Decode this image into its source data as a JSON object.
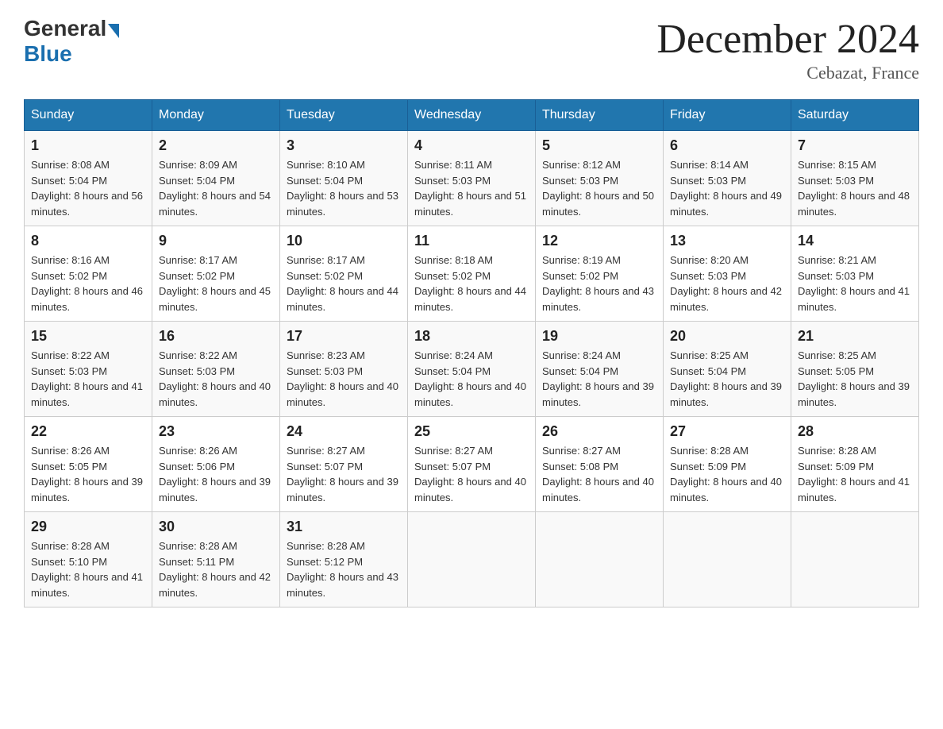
{
  "header": {
    "logo_general": "General",
    "logo_blue": "Blue",
    "title": "December 2024",
    "location": "Cebazat, France"
  },
  "days_of_week": [
    "Sunday",
    "Monday",
    "Tuesday",
    "Wednesday",
    "Thursday",
    "Friday",
    "Saturday"
  ],
  "weeks": [
    [
      {
        "day": "1",
        "sunrise": "8:08 AM",
        "sunset": "5:04 PM",
        "daylight": "8 hours and 56 minutes."
      },
      {
        "day": "2",
        "sunrise": "8:09 AM",
        "sunset": "5:04 PM",
        "daylight": "8 hours and 54 minutes."
      },
      {
        "day": "3",
        "sunrise": "8:10 AM",
        "sunset": "5:04 PM",
        "daylight": "8 hours and 53 minutes."
      },
      {
        "day": "4",
        "sunrise": "8:11 AM",
        "sunset": "5:03 PM",
        "daylight": "8 hours and 51 minutes."
      },
      {
        "day": "5",
        "sunrise": "8:12 AM",
        "sunset": "5:03 PM",
        "daylight": "8 hours and 50 minutes."
      },
      {
        "day": "6",
        "sunrise": "8:14 AM",
        "sunset": "5:03 PM",
        "daylight": "8 hours and 49 minutes."
      },
      {
        "day": "7",
        "sunrise": "8:15 AM",
        "sunset": "5:03 PM",
        "daylight": "8 hours and 48 minutes."
      }
    ],
    [
      {
        "day": "8",
        "sunrise": "8:16 AM",
        "sunset": "5:02 PM",
        "daylight": "8 hours and 46 minutes."
      },
      {
        "day": "9",
        "sunrise": "8:17 AM",
        "sunset": "5:02 PM",
        "daylight": "8 hours and 45 minutes."
      },
      {
        "day": "10",
        "sunrise": "8:17 AM",
        "sunset": "5:02 PM",
        "daylight": "8 hours and 44 minutes."
      },
      {
        "day": "11",
        "sunrise": "8:18 AM",
        "sunset": "5:02 PM",
        "daylight": "8 hours and 44 minutes."
      },
      {
        "day": "12",
        "sunrise": "8:19 AM",
        "sunset": "5:02 PM",
        "daylight": "8 hours and 43 minutes."
      },
      {
        "day": "13",
        "sunrise": "8:20 AM",
        "sunset": "5:03 PM",
        "daylight": "8 hours and 42 minutes."
      },
      {
        "day": "14",
        "sunrise": "8:21 AM",
        "sunset": "5:03 PM",
        "daylight": "8 hours and 41 minutes."
      }
    ],
    [
      {
        "day": "15",
        "sunrise": "8:22 AM",
        "sunset": "5:03 PM",
        "daylight": "8 hours and 41 minutes."
      },
      {
        "day": "16",
        "sunrise": "8:22 AM",
        "sunset": "5:03 PM",
        "daylight": "8 hours and 40 minutes."
      },
      {
        "day": "17",
        "sunrise": "8:23 AM",
        "sunset": "5:03 PM",
        "daylight": "8 hours and 40 minutes."
      },
      {
        "day": "18",
        "sunrise": "8:24 AM",
        "sunset": "5:04 PM",
        "daylight": "8 hours and 40 minutes."
      },
      {
        "day": "19",
        "sunrise": "8:24 AM",
        "sunset": "5:04 PM",
        "daylight": "8 hours and 39 minutes."
      },
      {
        "day": "20",
        "sunrise": "8:25 AM",
        "sunset": "5:04 PM",
        "daylight": "8 hours and 39 minutes."
      },
      {
        "day": "21",
        "sunrise": "8:25 AM",
        "sunset": "5:05 PM",
        "daylight": "8 hours and 39 minutes."
      }
    ],
    [
      {
        "day": "22",
        "sunrise": "8:26 AM",
        "sunset": "5:05 PM",
        "daylight": "8 hours and 39 minutes."
      },
      {
        "day": "23",
        "sunrise": "8:26 AM",
        "sunset": "5:06 PM",
        "daylight": "8 hours and 39 minutes."
      },
      {
        "day": "24",
        "sunrise": "8:27 AM",
        "sunset": "5:07 PM",
        "daylight": "8 hours and 39 minutes."
      },
      {
        "day": "25",
        "sunrise": "8:27 AM",
        "sunset": "5:07 PM",
        "daylight": "8 hours and 40 minutes."
      },
      {
        "day": "26",
        "sunrise": "8:27 AM",
        "sunset": "5:08 PM",
        "daylight": "8 hours and 40 minutes."
      },
      {
        "day": "27",
        "sunrise": "8:28 AM",
        "sunset": "5:09 PM",
        "daylight": "8 hours and 40 minutes."
      },
      {
        "day": "28",
        "sunrise": "8:28 AM",
        "sunset": "5:09 PM",
        "daylight": "8 hours and 41 minutes."
      }
    ],
    [
      {
        "day": "29",
        "sunrise": "8:28 AM",
        "sunset": "5:10 PM",
        "daylight": "8 hours and 41 minutes."
      },
      {
        "day": "30",
        "sunrise": "8:28 AM",
        "sunset": "5:11 PM",
        "daylight": "8 hours and 42 minutes."
      },
      {
        "day": "31",
        "sunrise": "8:28 AM",
        "sunset": "5:12 PM",
        "daylight": "8 hours and 43 minutes."
      },
      null,
      null,
      null,
      null
    ]
  ]
}
